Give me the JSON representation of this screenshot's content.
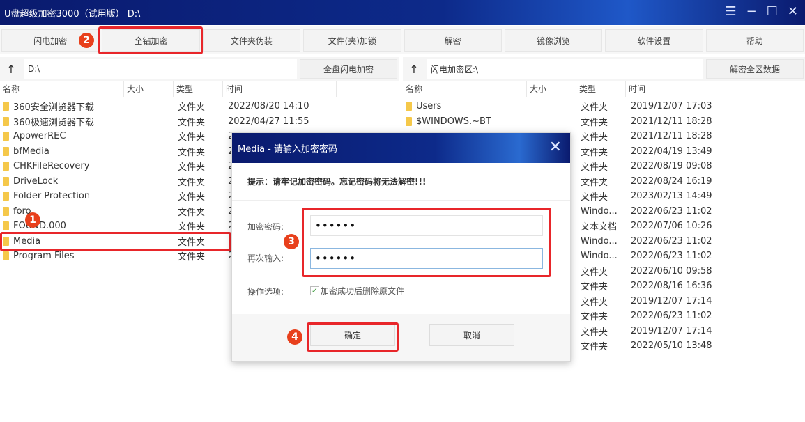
{
  "window": {
    "title": "U盘超级加密3000（试用版）  D:\\",
    "controls": [
      "menu-icon",
      "minimize-icon",
      "maximize-icon",
      "close-icon"
    ]
  },
  "toolbar": {
    "buttons": [
      "闪电加密",
      "全钻加密",
      "文件夹伪装",
      "文件(夹)加锁",
      "解密",
      "镜像浏览",
      "软件设置",
      "帮助"
    ]
  },
  "left": {
    "up_glyph": "↑",
    "path": "D:\\",
    "action": "全盘闪电加密",
    "columns": [
      "名称",
      "大小",
      "类型",
      "时间"
    ],
    "rows": [
      {
        "name": "360安全浏览器下载",
        "type": "文件夹",
        "time": "2022/08/20 14:10"
      },
      {
        "name": "360极速浏览器下载",
        "type": "文件夹",
        "time": "2022/04/27 11:55"
      },
      {
        "name": "ApowerREC",
        "type": "文件夹",
        "time": "2"
      },
      {
        "name": "bfMedia",
        "type": "文件夹",
        "time": "2"
      },
      {
        "name": "CHKFileRecovery",
        "type": "文件夹",
        "time": "2"
      },
      {
        "name": "DriveLock",
        "type": "文件夹",
        "time": "2"
      },
      {
        "name": "Folder Protection",
        "type": "文件夹",
        "time": "2"
      },
      {
        "name": "foro",
        "type": "文件夹",
        "time": "2"
      },
      {
        "name": "FOUND.000",
        "type": "文件夹",
        "time": "2"
      },
      {
        "name": "Media",
        "type": "文件夹",
        "time": ""
      },
      {
        "name": "Program Files",
        "type": "文件夹",
        "time": "2"
      }
    ]
  },
  "right": {
    "up_glyph": "↑",
    "path": "闪电加密区:\\",
    "action": "解密全区数据",
    "columns": [
      "名称",
      "大小",
      "类型",
      "时间"
    ],
    "rows": [
      {
        "name": "Users",
        "type": "文件夹",
        "time": "2019/12/07 17:03"
      },
      {
        "name": "$WINDOWS.~BT",
        "type": "文件夹",
        "time": "2021/12/11 18:28"
      },
      {
        "name": "",
        "type": "文件夹",
        "time": "2021/12/11 18:28"
      },
      {
        "name": "",
        "type": "文件夹",
        "time": "2022/04/19 13:49"
      },
      {
        "name": "",
        "type": "文件夹",
        "time": "2022/08/19 09:08"
      },
      {
        "name": "",
        "type": "文件夹",
        "time": "2022/08/24 16:19"
      },
      {
        "name": "",
        "type": "文件夹",
        "time": "2023/02/13 14:49"
      },
      {
        "name": "",
        "type": "Windo...",
        "time": "2022/06/23 11:02"
      },
      {
        "name": "",
        "type": "文本文档",
        "time": "2022/07/06 10:26"
      },
      {
        "name": "",
        "type": "Windo...",
        "time": "2022/06/23 11:02"
      },
      {
        "name": "",
        "type": "Windo...",
        "time": "2022/06/23 11:02"
      },
      {
        "name": "",
        "type": "文件夹",
        "time": "2022/06/10 09:58"
      },
      {
        "name": "",
        "type": "文件夹",
        "time": "2022/08/16 16:36"
      },
      {
        "name": "",
        "type": "文件夹",
        "time": "2019/12/07 17:14"
      },
      {
        "name": "",
        "type": "文件夹",
        "time": "2022/06/23 11:02"
      },
      {
        "name": "",
        "type": "文件夹",
        "time": "2019/12/07 17:14"
      },
      {
        "name": "",
        "type": "文件夹",
        "time": "2022/05/10 13:48"
      }
    ]
  },
  "dialog": {
    "title": "Media - 请输入加密密码",
    "close_glyph": "✕",
    "tip": "提示：请牢记加密密码。忘记密码将无法解密!!!",
    "password_label": "加密密码:",
    "password_value": "••••••",
    "confirm_label": "再次输入:",
    "confirm_value": "••••••",
    "options_label": "操作选项:",
    "delete_original_label": "加密成功后删除原文件",
    "delete_original_checked": true,
    "ok": "确定",
    "cancel": "取消"
  },
  "annotations": {
    "badges": [
      "1",
      "2",
      "3",
      "4"
    ],
    "color": "#e8262a"
  }
}
